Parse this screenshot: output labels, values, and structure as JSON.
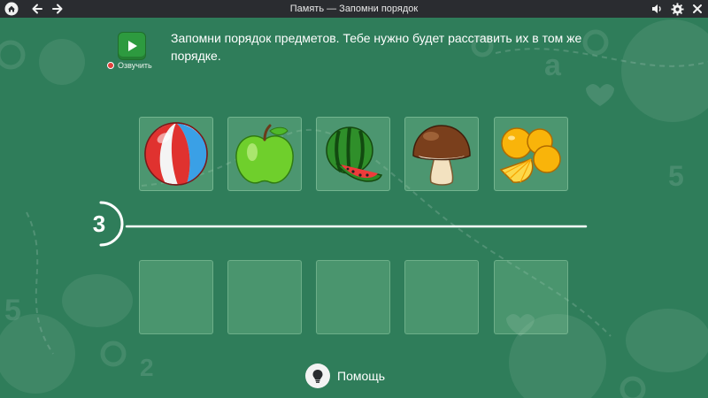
{
  "window": {
    "title": "Память — Запомни порядок"
  },
  "topbar": {
    "home_icon": "home-icon",
    "back_icon": "arrow-left-icon",
    "forward_icon": "arrow-right-icon",
    "sound_icon": "speaker-icon",
    "settings_icon": "gear-icon",
    "close_icon": "close-icon"
  },
  "task": {
    "instruction": "Запомни порядок предметов. Тебе нужно будет расставить их в том же порядке.",
    "voice_label": "Озвучить"
  },
  "items": [
    {
      "name": "beach-ball",
      "icon": "ball-icon"
    },
    {
      "name": "apple",
      "icon": "apple-icon"
    },
    {
      "name": "watermelon",
      "icon": "watermelon-icon"
    },
    {
      "name": "mushroom",
      "icon": "mushroom-icon"
    },
    {
      "name": "oranges",
      "icon": "orange-icon"
    }
  ],
  "timer": {
    "value": "3"
  },
  "slots_count": 5,
  "help": {
    "label": "Помощь"
  },
  "colors": {
    "background": "#2f7d5a",
    "topbar": "#2a2c30",
    "play": "#2d9a3f"
  }
}
